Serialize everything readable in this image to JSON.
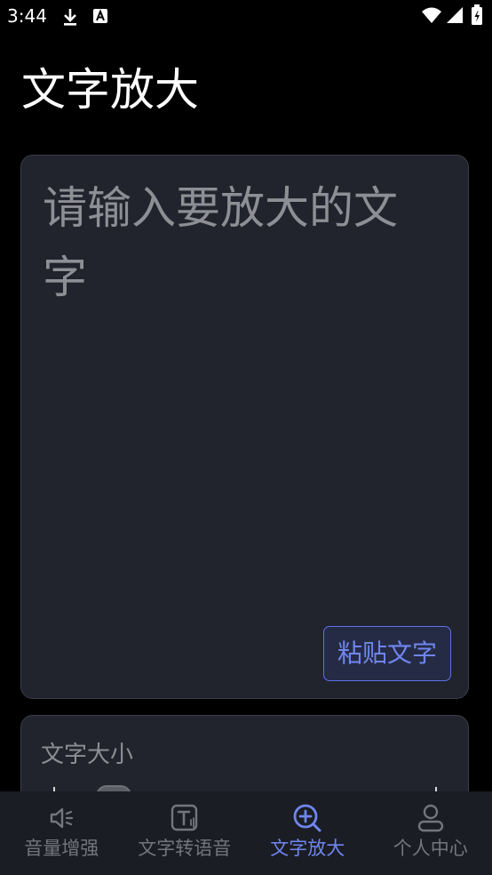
{
  "status_bar": {
    "time": "3:44",
    "icons": [
      "download-icon",
      "a-text-icon",
      "wifi-icon",
      "signal-icon",
      "battery-icon"
    ]
  },
  "page": {
    "title": "文字放大"
  },
  "input_card": {
    "placeholder": "请输入要放大的文字",
    "value": "",
    "paste_label": "粘贴文字"
  },
  "size_card": {
    "label": "文字大小"
  },
  "bottom_nav": {
    "items": [
      {
        "label": "音量增强",
        "icon": "speaker-icon",
        "active": false
      },
      {
        "label": "文字转语音",
        "icon": "text-to-speech-icon",
        "active": false
      },
      {
        "label": "文字放大",
        "icon": "zoom-in-icon",
        "active": true
      },
      {
        "label": "个人中心",
        "icon": "user-icon",
        "active": false
      }
    ]
  },
  "colors": {
    "background": "#000000",
    "card": "#21232d",
    "card_border": "#3b3e4a",
    "accent": "#6f86f2",
    "placeholder": "#8e8f95",
    "nav_background": "#1b1d24",
    "nav_inactive": "#74767d"
  }
}
